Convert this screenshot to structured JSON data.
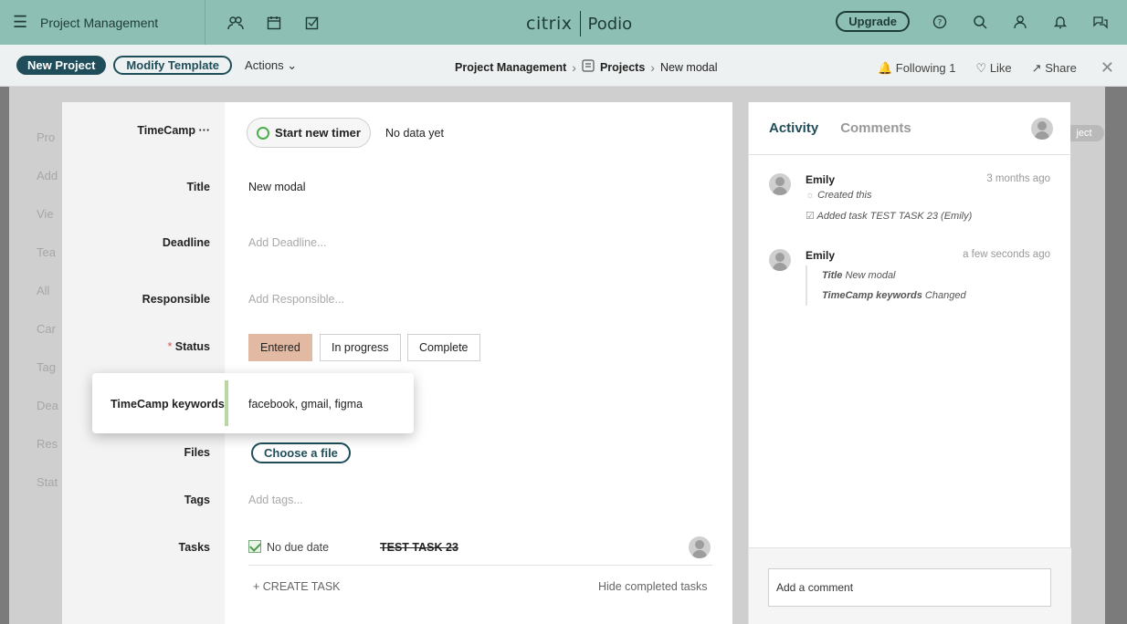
{
  "topbar": {
    "menu_icon": "hamburger-icon",
    "title": "Project Management",
    "icons": [
      "people-icon",
      "calendar-icon",
      "checkbox-icon"
    ],
    "logo_brand": "citrix",
    "logo_product": "Podio",
    "upgrade_label": "Upgrade",
    "right_icons": [
      "help-icon",
      "search-icon",
      "user-icon",
      "bell-icon",
      "chat-icon"
    ],
    "bg_color": "#8dbfb5"
  },
  "subbar": {
    "new_project_label": "New Project",
    "modify_template_label": "Modify Template",
    "actions_label": "Actions",
    "breadcrumb": {
      "workspace": "Project Management",
      "app": "Projects",
      "item": "New modal"
    },
    "following_label": "Following",
    "following_count": "1",
    "like_label": "Like",
    "share_label": "Share"
  },
  "background": {
    "labels": [
      "Pro",
      "Add",
      "Vie",
      "Tea",
      "All",
      "Car",
      "Tag",
      "Dea",
      "Res",
      "Stat"
    ],
    "right_button": "ject"
  },
  "form": {
    "timecamp_label": "TimeCamp ···",
    "timer_button": "Start new timer",
    "timer_status": "No data yet",
    "title_label": "Title",
    "title_value": "New modal",
    "deadline_label": "Deadline",
    "deadline_placeholder": "Add Deadline...",
    "responsible_label": "Responsible",
    "responsible_placeholder": "Add Responsible...",
    "status_required": "*",
    "status_label": "Status",
    "status_options": [
      "Entered",
      "In progress",
      "Complete"
    ],
    "status_selected": "Entered",
    "keywords_label": "TimeCamp keywords",
    "keywords_value": "facebook, gmail, figma",
    "files_label": "Files",
    "files_button": "Choose a file",
    "tags_label": "Tags",
    "tags_placeholder": "Add tags...",
    "tasks_label": "Tasks",
    "task": {
      "due": "No due date",
      "name": "TEST TASK 23"
    },
    "create_task": "+ CREATE TASK",
    "hide_completed": "Hide completed tasks"
  },
  "activity": {
    "tab_activity": "Activity",
    "tab_comments": "Comments",
    "entries": [
      {
        "user": "Emily",
        "time": "3 months ago",
        "line1": "Created this",
        "line2": "Added task TEST TASK 23 (Emily)"
      },
      {
        "user": "Emily",
        "time": "a few seconds ago",
        "change1_field": "Title",
        "change1_value": "New modal",
        "change2_field": "TimeCamp keywords",
        "change2_value": "Changed"
      }
    ],
    "comment_placeholder": "Add a comment"
  }
}
